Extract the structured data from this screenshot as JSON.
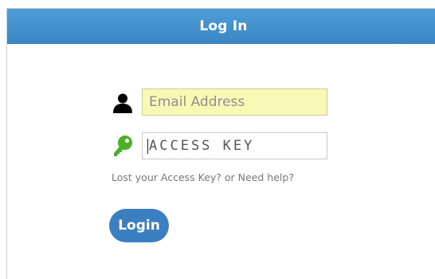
{
  "header": {
    "title": "Log In"
  },
  "form": {
    "email": {
      "placeholder": "Email Address",
      "value": "",
      "icon": "user-icon"
    },
    "access_key": {
      "placeholder": "ACCESS KEY",
      "value": "",
      "icon": "key-icon"
    },
    "help_link": "Lost your Access Key? or Need help?",
    "login_label": "Login"
  },
  "colors": {
    "header": "#4a99d2",
    "email_field_bg": "#f9f8b4",
    "login_button": "#3a7fc0",
    "key_icon": "#4caf28",
    "user_icon": "#000000"
  }
}
